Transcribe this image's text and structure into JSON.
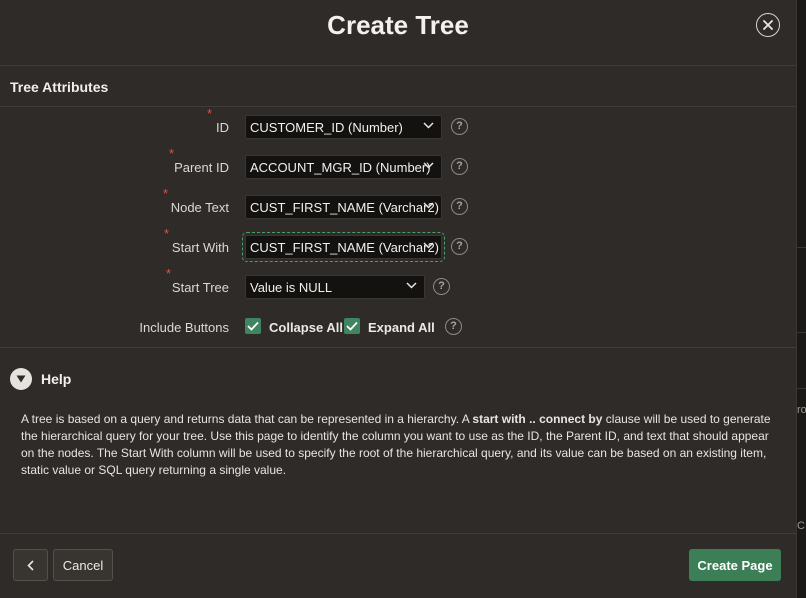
{
  "dialog": {
    "title": "Create Tree"
  },
  "section": {
    "title": "Tree Attributes"
  },
  "fields": [
    {
      "label": "ID",
      "required": true,
      "value": "CUSTOMER_ID (Number)"
    },
    {
      "label": "Parent ID",
      "required": true,
      "value": "ACCOUNT_MGR_ID (Number)"
    },
    {
      "label": "Node Text",
      "required": true,
      "value": "CUST_FIRST_NAME (Varchar2)"
    },
    {
      "label": "Start With",
      "required": true,
      "value": "CUST_FIRST_NAME (Varchar2)"
    },
    {
      "label": "Start Tree",
      "required": true,
      "value": "Value is NULL"
    }
  ],
  "include_buttons": {
    "label": "Include Buttons",
    "options": [
      {
        "label": "Collapse All",
        "checked": true
      },
      {
        "label": "Expand All",
        "checked": true
      }
    ]
  },
  "help_icon_glyph": "?",
  "help": {
    "title": "Help",
    "text_before": "A tree is based on a query and returns data that can be represented in a hierarchy. A ",
    "text_bold": "start with .. connect by",
    "text_after": " clause will be used to generate the hierarchical query for your tree. Use this page to identify the column you want to use as the ID, the Parent ID, and text that should appear on the nodes. The Start With column will be used to specify the root of the hierarchical query, and its value can be based on an existing item, static value or SQL query returning a single value."
  },
  "footer": {
    "cancel_label": "Cancel",
    "create_label": "Create Page"
  },
  "background_fragments": [
    "ro",
    "C"
  ],
  "colors": {
    "accent_green": "#3c7f57",
    "required_red": "#e0504a",
    "dialog_bg": "#2f2b28"
  }
}
